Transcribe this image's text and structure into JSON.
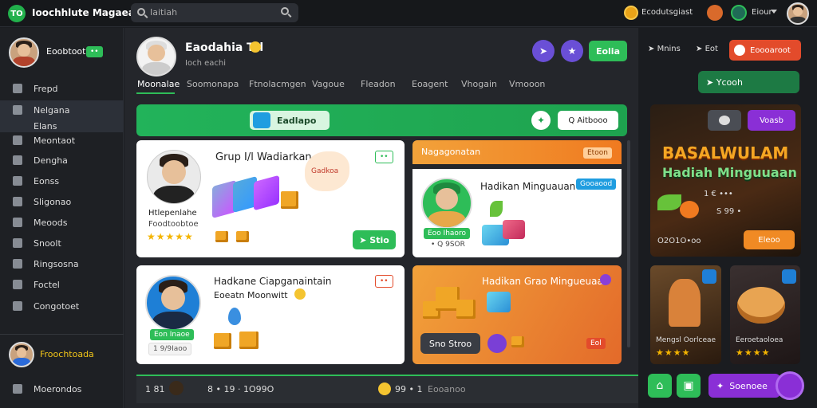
{
  "topbar": {
    "logo_icon": "TO",
    "app_name": "Ioochhlute Magaea",
    "search_value": "Iaitiah",
    "coin_label": "Ecodutsgiast",
    "user_label": "Eiour"
  },
  "sidebar": {
    "profile_name": "Eoobtoot",
    "profile_badge": "••",
    "items": [
      {
        "label": "Frepd"
      },
      {
        "label": "Nelgana"
      },
      {
        "label": "Elans"
      },
      {
        "label": "Meontaot"
      },
      {
        "label": "Dengha"
      },
      {
        "label": "Eonss"
      },
      {
        "label": "Sligonao"
      },
      {
        "label": "Meoods"
      },
      {
        "label": "Snoolt"
      },
      {
        "label": "Ringsosna"
      },
      {
        "label": "Foctel"
      },
      {
        "label": "Congotoet"
      }
    ],
    "footer_user": "Froochtoada",
    "footer_item": "Moerondos"
  },
  "main": {
    "header_name": "Eaodahia Ttl",
    "header_sub": "Ioch eachi",
    "tabs": [
      "Moonalae",
      "Soomonapa",
      "Ftnolacmgen",
      "Vagoue",
      "Fleadon",
      "Eoagent",
      "Vhogain",
      "Vmooon"
    ],
    "header_button": "Eolia",
    "banner_button": "Eadlapo",
    "banner_right": "Q Aitbooo",
    "card1": {
      "title": "Grup I/l Wadiarkan",
      "name": "Htlepenlahe",
      "sub": "Foodtoobtoe",
      "badge": "••",
      "tag": "Gadkoa",
      "button": "Stio"
    },
    "card2": {
      "header": "Nagagonatan",
      "header_badge": "Etoon",
      "title": "Hadikan Minguauan",
      "badge": "Gooaood",
      "label1": "Eoo Ihaoro",
      "label2": "• Q 9SOR"
    },
    "card3": {
      "title": "Hadkane Ciapganaintain",
      "sub": "Eoeatn Moonwitt",
      "label1": "Eon Inaoe",
      "label2": "1 9/9Ιaoo",
      "badge": "••"
    },
    "card4": {
      "title": "Hadikan Grao Mingueuaat",
      "button": "Sno Stroo",
      "tag": "Eol"
    },
    "bottombar": {
      "left": "1 81",
      "mid": "8 • 19 · 1O99O",
      "right1": "99 • 1",
      "right2": "Eooanoo"
    }
  },
  "right": {
    "top_items": [
      "Mnins",
      "Eot"
    ],
    "top_button": "Eoooaroot",
    "green_pill": "Ycooh",
    "promo": {
      "btn1": "",
      "btn2": "Voasb",
      "title1": "BASALWULAM",
      "title2": "Hadiah Minguuaan",
      "stat1": "1 € •••",
      "stat2": "S 99 •",
      "footer_left": "O2O1O•oo",
      "footer_btn": "Eleoo"
    },
    "card_a": {
      "label": "Mengsl Oorlceae"
    },
    "card_b": {
      "label": "Eeroetaoloea"
    },
    "bottom_button": "Soenoee"
  },
  "colors": {
    "green": "#2ebd58",
    "purple": "#6a4fd6",
    "orange": "#f08a24",
    "red": "#e34b2b"
  }
}
